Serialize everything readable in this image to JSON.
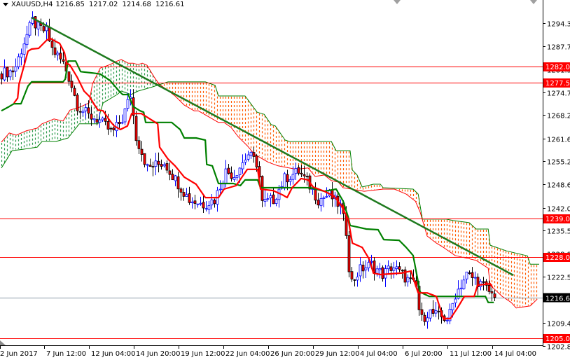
{
  "header": {
    "symbol_timeframe": "XAUUSD,H4",
    "open": "1216.85",
    "high": "1217.02",
    "low": "1214.68",
    "close": "1216.61"
  },
  "colors": {
    "bull_body": "#ffffff",
    "bull_outline": "#0000ff",
    "bear_body": "#ff0000",
    "bear_outline": "#000000",
    "tenkan": "#ff0000",
    "kijun": "#008000",
    "span_a": "#ff0000",
    "span_b": "#008000",
    "cloud_bull": "#2e9b4e",
    "cloud_bear": "#ff5a00",
    "trendline": "#1e7a1e",
    "level": "#ff0000",
    "current_price_line": "#8a99a6",
    "current_price_label": "#000000"
  },
  "chart_data": {
    "type": "candlestick",
    "title": "XAUUSD,H4",
    "xlabel": "",
    "ylabel": "",
    "ylim": [
      1203.0,
      1300.9
    ],
    "bars_per_x_tick": 16,
    "x_ticks": [
      "2 Jun 2017",
      "7 Jun 12:00",
      "12 Jun 04:00",
      "14 Jun 20:00",
      "19 Jun 12:00",
      "22 Jun 04:00",
      "26 Jun 20:00",
      "29 Jun 12:00",
      "4 Jul 04:00",
      "6 Jul 20:00",
      "11 Jul 12:00",
      "14 Jul 04:00"
    ],
    "y_ticks": [
      "1294.35",
      "1287.75",
      "1281.30",
      "1274.70",
      "1268.25",
      "1261.65",
      "1255.20",
      "1248.60",
      "1242.00",
      "1235.55",
      "1228.95",
      "1222.50",
      "1216.05",
      "1209.45",
      "1202.85"
    ],
    "bar_count": 177,
    "close_path": [
      [
        0,
        1280.1
      ],
      [
        4.5,
        1281.0
      ],
      [
        8,
        1289.0
      ],
      [
        11,
        1295.0
      ],
      [
        13,
        1293.0
      ],
      [
        16,
        1292.0
      ],
      [
        18,
        1287.0
      ],
      [
        22,
        1283.0
      ],
      [
        24.5,
        1278.0
      ],
      [
        27,
        1271.1
      ],
      [
        31,
        1268.1
      ],
      [
        34.5,
        1267.1
      ],
      [
        39.5,
        1263.2
      ],
      [
        43,
        1267.1
      ],
      [
        46,
        1274.1
      ],
      [
        48,
        1262.2
      ],
      [
        52,
        1253.3
      ],
      [
        58,
        1254.9
      ],
      [
        63,
        1248.9
      ],
      [
        67,
        1244.3
      ],
      [
        72,
        1243.0
      ],
      [
        76,
        1244.3
      ],
      [
        80,
        1252.3
      ],
      [
        83,
        1251.3
      ],
      [
        88,
        1257.2
      ],
      [
        91.5,
        1254.3
      ],
      [
        93,
        1243.3
      ],
      [
        97,
        1244.3
      ],
      [
        101,
        1250.3
      ],
      [
        106,
        1252.3
      ],
      [
        109.5,
        1248.9
      ],
      [
        113,
        1244.3
      ],
      [
        117,
        1245.7
      ],
      [
        121,
        1242.3
      ],
      [
        123,
        1235.4
      ],
      [
        124.5,
        1220.5
      ],
      [
        128,
        1224.5
      ],
      [
        132,
        1225.9
      ],
      [
        136,
        1223.1
      ],
      [
        139.5,
        1225.5
      ],
      [
        144.5,
        1221.9
      ],
      [
        148,
        1219.5
      ],
      [
        149.5,
        1210.0
      ],
      [
        152.5,
        1212.6
      ],
      [
        156,
        1211.2
      ],
      [
        159.5,
        1210.6
      ],
      [
        162,
        1217.5
      ],
      [
        166,
        1223.1
      ],
      [
        169.5,
        1221.5
      ],
      [
        173,
        1219.1
      ],
      [
        176,
        1216.61
      ]
    ],
    "series": [
      {
        "name": "Tenkan-sen",
        "points": [
          [
            4.5,
            1271.7
          ],
          [
            5.8,
            1273.1
          ],
          [
            6.3,
            1277.1
          ],
          [
            9.5,
            1286.4
          ],
          [
            10.8,
            1287.0
          ],
          [
            13.3,
            1287.2
          ],
          [
            16.3,
            1289.6
          ],
          [
            17.5,
            1290.0
          ],
          [
            18.8,
            1289.4
          ],
          [
            20.8,
            1288.6
          ],
          [
            22.5,
            1286.0
          ],
          [
            23.3,
            1283.0
          ],
          [
            24.5,
            1282.4
          ],
          [
            27,
            1279.1
          ],
          [
            29.5,
            1275.1
          ],
          [
            31.5,
            1273.5
          ],
          [
            32.8,
            1271.7
          ],
          [
            34.5,
            1269.7
          ],
          [
            36.3,
            1269.5
          ],
          [
            38.8,
            1266.6
          ],
          [
            40.3,
            1265.2
          ],
          [
            42.5,
            1264.2
          ],
          [
            45,
            1265.2
          ],
          [
            46.5,
            1268.7
          ],
          [
            50,
            1268.7
          ],
          [
            55.8,
            1265.8
          ],
          [
            56.5,
            1259.2
          ],
          [
            59.5,
            1255.8
          ],
          [
            62,
            1253.9
          ],
          [
            65.3,
            1250.7
          ],
          [
            69.5,
            1248.7
          ],
          [
            72.8,
            1244.9
          ],
          [
            77.5,
            1244.9
          ],
          [
            79.5,
            1247.3
          ],
          [
            83.8,
            1248.3
          ],
          [
            87.8,
            1252.9
          ],
          [
            91.5,
            1252.9
          ],
          [
            92.5,
            1247.3
          ],
          [
            97,
            1246.9
          ],
          [
            100.3,
            1245.7
          ],
          [
            102,
            1244.9
          ],
          [
            103.8,
            1247.7
          ],
          [
            107,
            1250.3
          ],
          [
            109.5,
            1249.9
          ],
          [
            111.3,
            1247.9
          ],
          [
            115.3,
            1246.7
          ],
          [
            118.8,
            1245.3
          ],
          [
            121.3,
            1242.7
          ],
          [
            123.8,
            1238.8
          ],
          [
            125.3,
            1232.0
          ],
          [
            128.8,
            1230.8
          ],
          [
            131.3,
            1227.5
          ],
          [
            132.8,
            1223.5
          ],
          [
            135.3,
            1223.1
          ],
          [
            142.8,
            1223.5
          ],
          [
            146.3,
            1224.1
          ],
          [
            147,
            1222.1
          ],
          [
            148.8,
            1217.9
          ],
          [
            152,
            1217.9
          ],
          [
            155.3,
            1216.9
          ],
          [
            157.8,
            1210.6
          ],
          [
            160.3,
            1210.6
          ],
          [
            162.8,
            1213.6
          ],
          [
            165.3,
            1216.9
          ],
          [
            168.8,
            1216.9
          ],
          [
            170,
            1220.1
          ],
          [
            174.5,
            1220.5
          ],
          [
            175.3,
            1219.5
          ]
        ]
      },
      {
        "name": "Kijun-sen",
        "points": [
          [
            0,
            1269.5
          ],
          [
            2.8,
            1270.7
          ],
          [
            4.5,
            1271.5
          ],
          [
            7,
            1271.5
          ],
          [
            7.8,
            1273.1
          ],
          [
            9.5,
            1276.5
          ],
          [
            10.8,
            1277.7
          ],
          [
            22,
            1277.7
          ],
          [
            22.8,
            1278.5
          ],
          [
            23.8,
            1283.6
          ],
          [
            26.5,
            1283.6
          ],
          [
            28.3,
            1280.6
          ],
          [
            33.8,
            1280.1
          ],
          [
            35.3,
            1279.9
          ],
          [
            38.8,
            1278.1
          ],
          [
            42,
            1275.1
          ],
          [
            43.3,
            1274.1
          ],
          [
            45.3,
            1274.1
          ],
          [
            47,
            1270.7
          ],
          [
            49.5,
            1269.5
          ],
          [
            50.8,
            1269.1
          ],
          [
            51.5,
            1266.2
          ],
          [
            60.8,
            1266.2
          ],
          [
            63.8,
            1264.2
          ],
          [
            65.3,
            1261.8
          ],
          [
            69.5,
            1261.8
          ],
          [
            72.8,
            1261.2
          ],
          [
            73.3,
            1254.3
          ],
          [
            75.3,
            1253.9
          ],
          [
            77.5,
            1248.9
          ],
          [
            82.8,
            1248.9
          ],
          [
            85.3,
            1248.3
          ],
          [
            87,
            1249.9
          ],
          [
            91.5,
            1249.9
          ],
          [
            92.5,
            1247.7
          ],
          [
            110.3,
            1247.7
          ],
          [
            115.3,
            1246.7
          ],
          [
            119.5,
            1247.3
          ],
          [
            122,
            1243.9
          ],
          [
            123.8,
            1239.4
          ],
          [
            124.5,
            1237.0
          ],
          [
            130.3,
            1236.0
          ],
          [
            134.5,
            1235.8
          ],
          [
            136.5,
            1233.0
          ],
          [
            142,
            1232.8
          ],
          [
            144.5,
            1230.8
          ],
          [
            147,
            1228.5
          ],
          [
            148.8,
            1220.9
          ],
          [
            149.5,
            1218.1
          ],
          [
            152.8,
            1216.9
          ],
          [
            172.8,
            1216.9
          ],
          [
            173.8,
            1215.2
          ],
          [
            175.8,
            1215.2
          ]
        ]
      },
      {
        "name": "Senkou Span A",
        "points": [
          [
            0,
            1260.6
          ],
          [
            2.8,
            1263.2
          ],
          [
            5.3,
            1262.6
          ],
          [
            8.8,
            1263.8
          ],
          [
            12.8,
            1264.6
          ],
          [
            14.5,
            1265.8
          ],
          [
            18.8,
            1267.2
          ],
          [
            22,
            1266.6
          ],
          [
            24.5,
            1269.7
          ],
          [
            27.8,
            1270.5
          ],
          [
            31.3,
            1271.7
          ],
          [
            32.5,
            1277.1
          ],
          [
            35.3,
            1281.6
          ],
          [
            38.8,
            1282.6
          ],
          [
            41.3,
            1283.6
          ],
          [
            42.8,
            1284.0
          ],
          [
            45.3,
            1283.0
          ],
          [
            47,
            1283.0
          ],
          [
            48.8,
            1282.6
          ],
          [
            50.3,
            1283.0
          ],
          [
            52,
            1282.4
          ],
          [
            54.5,
            1279.1
          ],
          [
            56.3,
            1277.1
          ],
          [
            62,
            1273.7
          ],
          [
            65.3,
            1271.1
          ],
          [
            68.8,
            1269.5
          ],
          [
            70.3,
            1269.5
          ],
          [
            77.5,
            1266.2
          ],
          [
            79.5,
            1266.2
          ],
          [
            82,
            1264.8
          ],
          [
            84.5,
            1262.2
          ],
          [
            87.8,
            1259.6
          ],
          [
            90.3,
            1257.2
          ],
          [
            95.3,
            1254.9
          ],
          [
            98.8,
            1253.9
          ],
          [
            105.3,
            1252.9
          ],
          [
            109.5,
            1253.3
          ],
          [
            112,
            1250.9
          ],
          [
            115.3,
            1251.3
          ],
          [
            117.8,
            1249.7
          ],
          [
            120.3,
            1249.3
          ],
          [
            122,
            1247.7
          ],
          [
            129.5,
            1246.7
          ],
          [
            136.3,
            1247.3
          ],
          [
            140.3,
            1247.3
          ],
          [
            144.5,
            1245.9
          ],
          [
            147.8,
            1243.9
          ],
          [
            149.5,
            1240.8
          ],
          [
            152,
            1234.0
          ],
          [
            155.3,
            1232.0
          ],
          [
            157.8,
            1230.8
          ],
          [
            162,
            1228.5
          ],
          [
            169.5,
            1227.1
          ],
          [
            173.8,
            1224.9
          ],
          [
            174.5,
            1220.1
          ],
          [
            178.8,
            1216.9
          ],
          [
            182,
            1215.2
          ],
          [
            183.8,
            1213.6
          ],
          [
            188.8,
            1214.2
          ],
          [
            191.3,
            1216.1
          ]
        ]
      },
      {
        "name": "Senkou Span B",
        "points": [
          [
            0,
            1253.3
          ],
          [
            2,
            1255.8
          ],
          [
            3.8,
            1258.2
          ],
          [
            7.8,
            1258.6
          ],
          [
            12.8,
            1259.2
          ],
          [
            14.5,
            1260.8
          ],
          [
            19.5,
            1260.8
          ],
          [
            23.8,
            1261.8
          ],
          [
            27.8,
            1265.8
          ],
          [
            34.5,
            1265.8
          ],
          [
            35.3,
            1269.1
          ],
          [
            36.3,
            1271.7
          ],
          [
            41.3,
            1274.1
          ],
          [
            42.8,
            1275.1
          ],
          [
            46.3,
            1274.1
          ],
          [
            48.8,
            1275.1
          ],
          [
            53.3,
            1276.1
          ],
          [
            59.5,
            1277.7
          ],
          [
            72.8,
            1277.7
          ],
          [
            76.3,
            1276.7
          ],
          [
            77.5,
            1273.7
          ],
          [
            87,
            1273.7
          ],
          [
            91.3,
            1269.1
          ],
          [
            93.8,
            1268.5
          ],
          [
            96.3,
            1265.6
          ],
          [
            97.8,
            1265.2
          ],
          [
            101.3,
            1261.2
          ],
          [
            102.8,
            1260.8
          ],
          [
            117.8,
            1260.8
          ],
          [
            119.5,
            1258.2
          ],
          [
            124.5,
            1258.2
          ],
          [
            125.3,
            1252.7
          ],
          [
            127,
            1251.3
          ],
          [
            128.8,
            1247.9
          ],
          [
            132.8,
            1248.7
          ],
          [
            135.3,
            1248.7
          ],
          [
            136.3,
            1247.7
          ],
          [
            147,
            1247.3
          ],
          [
            148.8,
            1245.9
          ],
          [
            150.3,
            1238.8
          ],
          [
            158.8,
            1238.8
          ],
          [
            161.3,
            1238.4
          ],
          [
            167,
            1237.8
          ],
          [
            169.5,
            1236.0
          ],
          [
            173.8,
            1236.0
          ],
          [
            174.5,
            1231.4
          ],
          [
            180.3,
            1229.8
          ],
          [
            187.8,
            1228.4
          ],
          [
            188.8,
            1226.0
          ],
          [
            192,
            1226.0
          ]
        ]
      }
    ],
    "trendline": {
      "start": [
        10.8,
        1295.9
      ],
      "end": [
        182.8,
        1222.9
      ]
    },
    "levels": [
      "1282.00",
      "1277.50",
      "1239.00",
      "1228.00",
      "1205.00"
    ],
    "current_price": "1216.61",
    "grid": false,
    "legend": "none"
  }
}
